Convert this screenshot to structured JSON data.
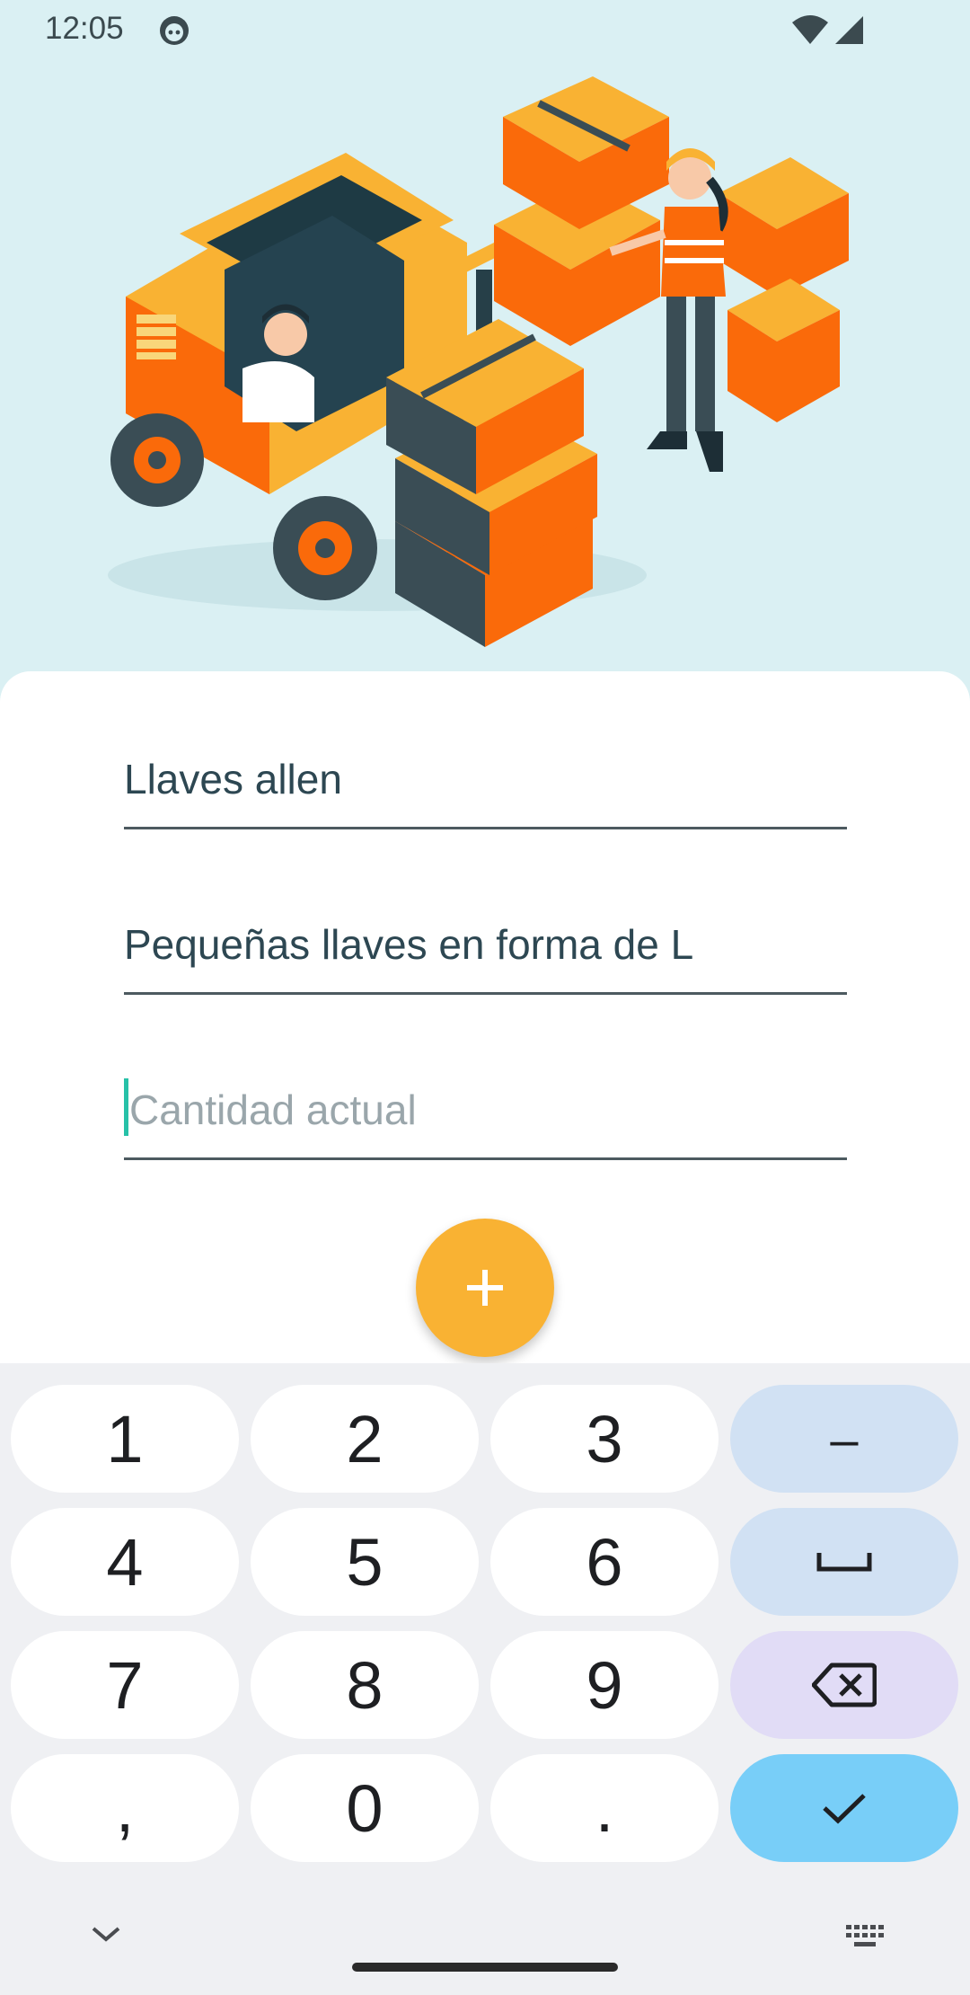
{
  "status_bar": {
    "time": "12:05",
    "icons": [
      "app-notification-icon",
      "wifi-icon",
      "cellular-signal-icon"
    ]
  },
  "hero": {
    "illustration": "warehouse-forklift-illustration"
  },
  "form": {
    "name_value": "Llaves allen",
    "description_value": "Pequeñas llaves en forma de L",
    "quantity_placeholder": "Cantidad actual",
    "quantity_value": ""
  },
  "fab": {
    "icon": "plus-icon",
    "color": "#f9b233"
  },
  "keyboard": {
    "rows": [
      [
        "1",
        "2",
        "3",
        "–"
      ],
      [
        "4",
        "5",
        "6",
        "␣"
      ],
      [
        "7",
        "8",
        "9",
        "⌫"
      ],
      [
        ",",
        "0",
        ".",
        "✓"
      ]
    ],
    "colors": {
      "background": "#eff0f3",
      "key": "#ffffff",
      "function_key": "#d1e1f3",
      "backspace_key": "#e1dcf6",
      "enter_key": "#78cef8"
    },
    "bottom_icons": [
      "collapse-keyboard-icon",
      "keyboard-switch-icon"
    ]
  },
  "colors": {
    "background": "#daf0f3",
    "accent": "#f9b233",
    "orange": "#fa6a0a"
  }
}
